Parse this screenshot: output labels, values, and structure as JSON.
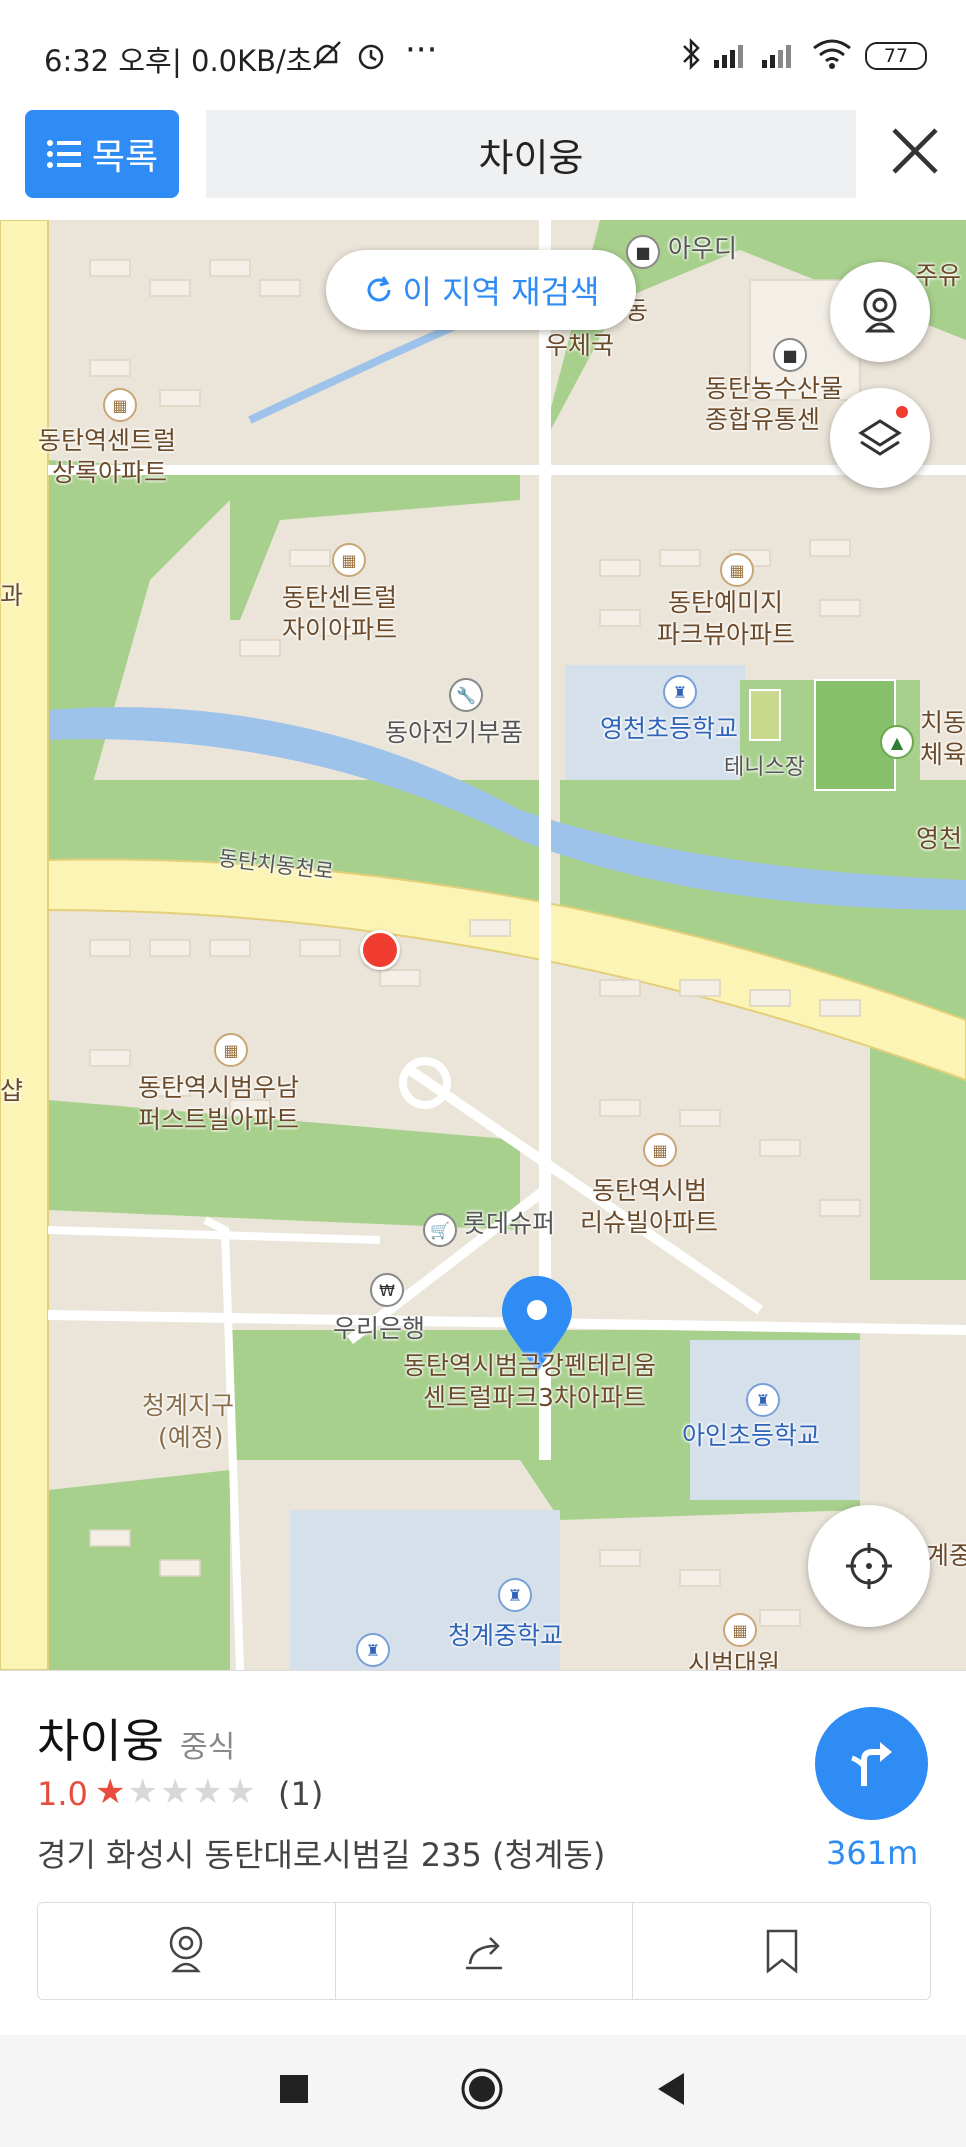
{
  "status_bar": {
    "time": "6:32 오후",
    "speed": "| 0.0KB/초",
    "battery": "77"
  },
  "header": {
    "list_label": "목록",
    "search_text": "차이웅"
  },
  "map": {
    "research_label": "이 지역 재검색",
    "labels": {
      "audi": "아우디",
      "dong": "동",
      "post": "우체국",
      "nonghyup1": "동탄농수산물",
      "nonghyup2": "종합유통센",
      "juyu": "주유",
      "central_sr1": "동탄역센트럴",
      "central_sr2": "상록아파트",
      "gwa": "과",
      "central_xi1": "동탄센트럴",
      "central_xi2": "자이아파트",
      "yemiji1": "동탄예미지",
      "yemiji2": "파크뷰아파트",
      "electric": "동아전기부품",
      "yeongcheon_es": "영천초등학교",
      "tennis": "테니스장",
      "chidong1": "치동",
      "chidong2": "체육",
      "yeongcheon": "영천",
      "road": "동탄치동천로",
      "woonam1": "동탄역시범우남",
      "woonam2": "퍼스트빌아파트",
      "syap": "샵",
      "rishu1": "동탄역시범",
      "rishu2": "리슈빌아파트",
      "lotte": "롯데슈퍼",
      "woori": "우리은행",
      "geumgang1": "동탄역시범금강펜테리움",
      "geumgang2": "센트럴파크3차아파트",
      "cheonggye1": "청계지구",
      "cheonggye2": "(예정)",
      "ain_es": "아인초등학교",
      "cheonggye_ms": "청계중학교",
      "sibeom": "시범대원",
      "gye": "계중"
    }
  },
  "place": {
    "name": "차이웅",
    "category": "중식",
    "rating": "1.0",
    "stars_filled": 1,
    "stars_total": 5,
    "review_count": "(1)",
    "address": "경기 화성시 동탄대로시범길 235 (청계동)",
    "distance": "361m"
  },
  "colors": {
    "accent": "#2f8cf5",
    "rating": "#e74c3c",
    "park": "#a8d08d",
    "water": "#9ec3ea",
    "main_road": "#fbf4b5"
  },
  "icons": [
    "list-icon",
    "close-icon",
    "refresh-icon",
    "street-view-icon",
    "layers-icon",
    "my-location-icon",
    "route-icon",
    "share-icon",
    "bookmark-icon"
  ]
}
